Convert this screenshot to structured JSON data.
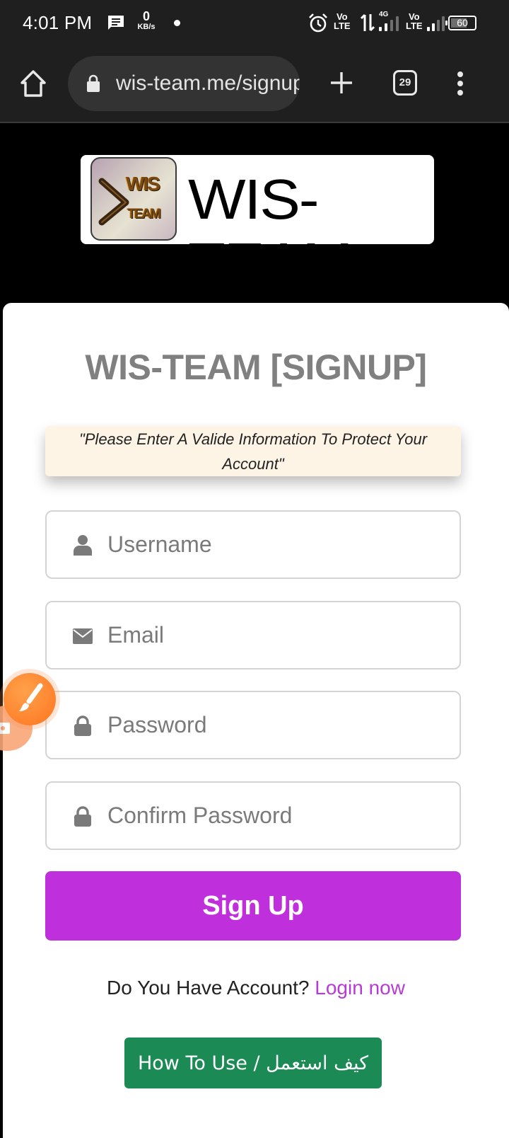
{
  "status_bar": {
    "time": "4:01 PM",
    "net_speed_value": "0",
    "net_speed_unit": "KB/s",
    "volte_top": "Vo",
    "volte_bottom": "LTE",
    "network_type": "4G",
    "battery_level": "60",
    "icons": [
      "message-icon",
      "alarm-icon",
      "data-arrows-icon",
      "signal-icon",
      "battery-icon"
    ]
  },
  "browser": {
    "url": "wis-team.me/signup",
    "url_visible": "wis-team.me/sigr",
    "tab_count": "29",
    "icons": [
      "home-icon",
      "lock-icon",
      "plus-icon",
      "tabs-icon",
      "more-vert-icon"
    ]
  },
  "logo": {
    "icon_line1": "WIS",
    "icon_line2": "TEAM",
    "wordmark": "WIS-TEAM"
  },
  "form": {
    "title": "WIS-TEAM [SIGNUP]",
    "notice": "\"Please Enter A Valide Information To Protect Your Account\"",
    "fields": [
      {
        "name": "username",
        "placeholder": "Username",
        "value": "",
        "icon": "user-icon"
      },
      {
        "name": "email",
        "placeholder": "Email",
        "value": "",
        "icon": "envelope-icon"
      },
      {
        "name": "password",
        "placeholder": "Password",
        "value": "",
        "icon": "lock-icon"
      },
      {
        "name": "confirm_password",
        "placeholder": "Confirm Password",
        "value": "",
        "icon": "lock-icon"
      }
    ],
    "submit_label": "Sign Up",
    "login_prompt": "Do You Have Account?",
    "login_link": "Login now",
    "howto_label": "How To Use / كيف استعمل"
  },
  "colors": {
    "accent_purple": "#bf2fdb",
    "link_purple": "#b83ad6",
    "howto_green": "#1c8a55",
    "notice_bg": "#fdf4e6",
    "title_gray": "#808080",
    "browser_bar": "#1f1f1f",
    "overlay_orange": "#ff7a22"
  }
}
